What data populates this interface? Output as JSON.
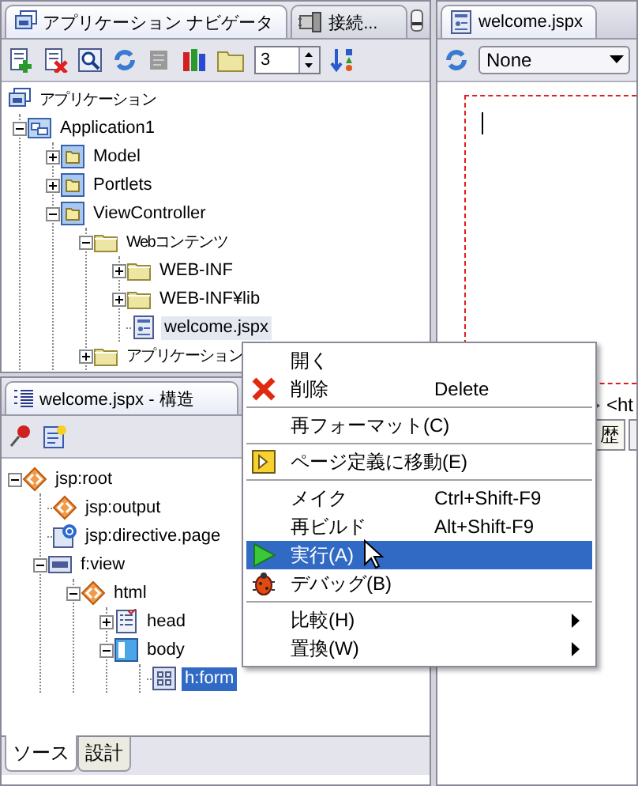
{
  "navigator": {
    "tabs": [
      {
        "label": "アプリケーション ナビゲータ",
        "selected": true
      },
      {
        "label": "接続...",
        "selected": false
      }
    ],
    "depth": "3",
    "tree": {
      "focused": false,
      "nodes": [
        {
          "label": "アプリケーション",
          "kind": "workspace",
          "selected": false,
          "children": [
            {
              "label": "Application1",
              "kind": "application",
              "expanded": true,
              "selected": false,
              "children": [
                {
                  "label": "Model",
                  "kind": "project",
                  "expanded": false,
                  "selected": false
                },
                {
                  "label": "Portlets",
                  "kind": "project",
                  "expanded": false,
                  "selected": false
                },
                {
                  "label": "ViewController",
                  "kind": "project",
                  "expanded": true,
                  "selected": false,
                  "children": [
                    {
                      "label": "Webコンテンツ",
                      "kind": "folder",
                      "expanded": true,
                      "selected": false,
                      "children": [
                        {
                          "label": "WEB-INF",
                          "kind": "folder",
                          "expanded": false,
                          "selected": false
                        },
                        {
                          "label": "WEB-INF¥lib",
                          "kind": "folder",
                          "expanded": false,
                          "selected": false
                        },
                        {
                          "label": "welcome.jspx",
                          "kind": "page",
                          "selected": true
                        }
                      ]
                    },
                    {
                      "label": "アプリケーション",
                      "kind": "folder",
                      "expanded": false,
                      "selected": false
                    }
                  ]
                }
              ]
            }
          ]
        }
      ]
    }
  },
  "editor": {
    "tab": {
      "label": "welcome.jspx",
      "selected": true
    },
    "view_select": "None",
    "breadcrumb": "<ht",
    "history_tab": "歴"
  },
  "structure": {
    "tab": "welcome.jspx - 構造",
    "tree": {
      "focused": true,
      "nodes": [
        {
          "label": "jsp:root",
          "kind": "tag",
          "expanded": true,
          "selected": false,
          "children": [
            {
              "label": "jsp:output",
              "kind": "tag",
              "selected": false
            },
            {
              "label": "jsp:directive.page",
              "kind": "directive",
              "selected": false
            },
            {
              "label": "f:view",
              "kind": "jsf",
              "expanded": true,
              "selected": false,
              "children": [
                {
                  "label": "html",
                  "kind": "tag",
                  "expanded": true,
                  "selected": false,
                  "children": [
                    {
                      "label": "head",
                      "kind": "head",
                      "expanded": false,
                      "selected": false
                    },
                    {
                      "label": "body",
                      "kind": "body",
                      "expanded": true,
                      "selected": false,
                      "children": [
                        {
                          "label": "h:form",
                          "kind": "form",
                          "selected": true
                        }
                      ]
                    }
                  ]
                }
              ]
            }
          ]
        }
      ]
    },
    "bottom_tabs": [
      {
        "label": "ソース",
        "selected": true
      },
      {
        "label": "設計",
        "selected": false
      }
    ]
  },
  "context_menu": [
    {
      "kind": "plain",
      "label": "開く",
      "selected": false
    },
    {
      "kind": "delete",
      "label": "削除",
      "shortcut": "Delete",
      "selected": false
    },
    {
      "kind": "separator"
    },
    {
      "kind": "plain",
      "label": "再フォーマット(C)",
      "selected": false
    },
    {
      "kind": "separator"
    },
    {
      "kind": "goto",
      "label": "ページ定義に移動(E)",
      "selected": false
    },
    {
      "kind": "separator"
    },
    {
      "kind": "plain",
      "label": "メイク",
      "shortcut": "Ctrl+Shift-F9",
      "selected": false
    },
    {
      "kind": "plain",
      "label": "再ビルド",
      "shortcut": "Alt+Shift-F9",
      "selected": false
    },
    {
      "kind": "run",
      "label": "実行(A)",
      "selected": true
    },
    {
      "kind": "debug",
      "label": "デバッグ(B)",
      "selected": false
    },
    {
      "kind": "separator"
    },
    {
      "kind": "submenu",
      "label": "比較(H)",
      "selected": false
    },
    {
      "kind": "submenu",
      "label": "置換(W)",
      "selected": false
    }
  ]
}
